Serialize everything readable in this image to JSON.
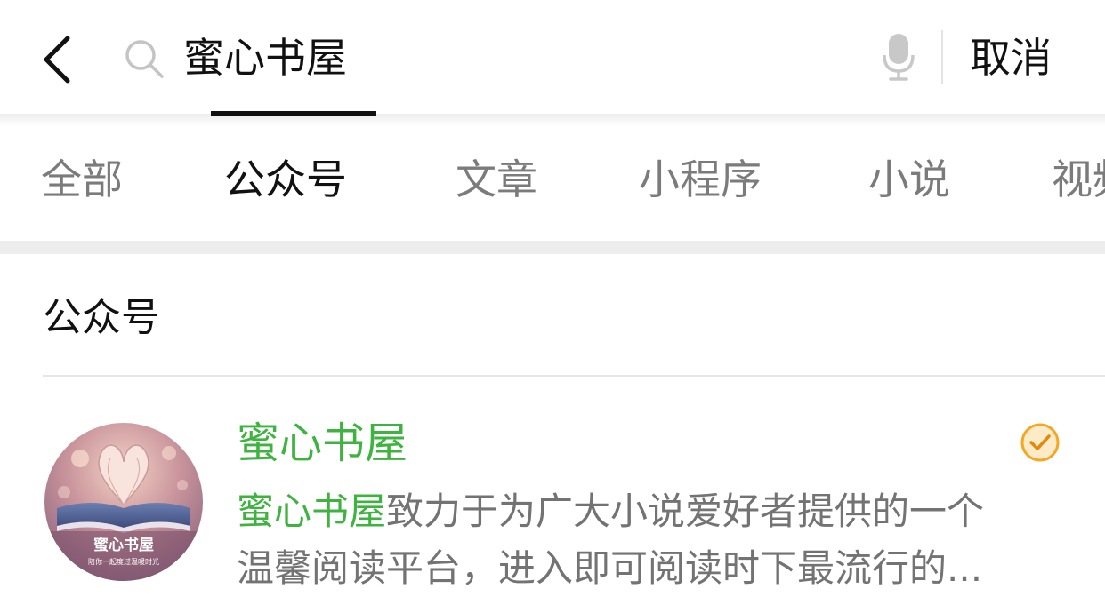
{
  "search": {
    "query": "蜜心书屋",
    "cancel_label": "取消"
  },
  "tabs": [
    {
      "label": "全部",
      "active": false
    },
    {
      "label": "公众号",
      "active": true
    },
    {
      "label": "文章",
      "active": false
    },
    {
      "label": "小程序",
      "active": false
    },
    {
      "label": "小说",
      "active": false
    },
    {
      "label": "视频",
      "active": false
    }
  ],
  "section": {
    "title": "公众号"
  },
  "result": {
    "name": "蜜心书屋",
    "verified": true,
    "desc_highlight": "蜜心书屋",
    "desc_line1": "致力于为广大小说爱好者提供的一个",
    "desc_line2": "温馨阅读平台，进入即可阅读时下最流行的...",
    "avatar": {
      "title": "蜜心书屋",
      "subtitle": "陪你一起度过温暖时光"
    }
  },
  "colors": {
    "accent_green": "#3fb33f",
    "verified_orange": "#f5a623",
    "text_primary": "#111111",
    "text_secondary": "#7b7b7b"
  },
  "icons": {
    "back": "chevron-left-icon",
    "search": "search-icon",
    "mic": "microphone-icon",
    "verified": "verified-check-icon"
  }
}
